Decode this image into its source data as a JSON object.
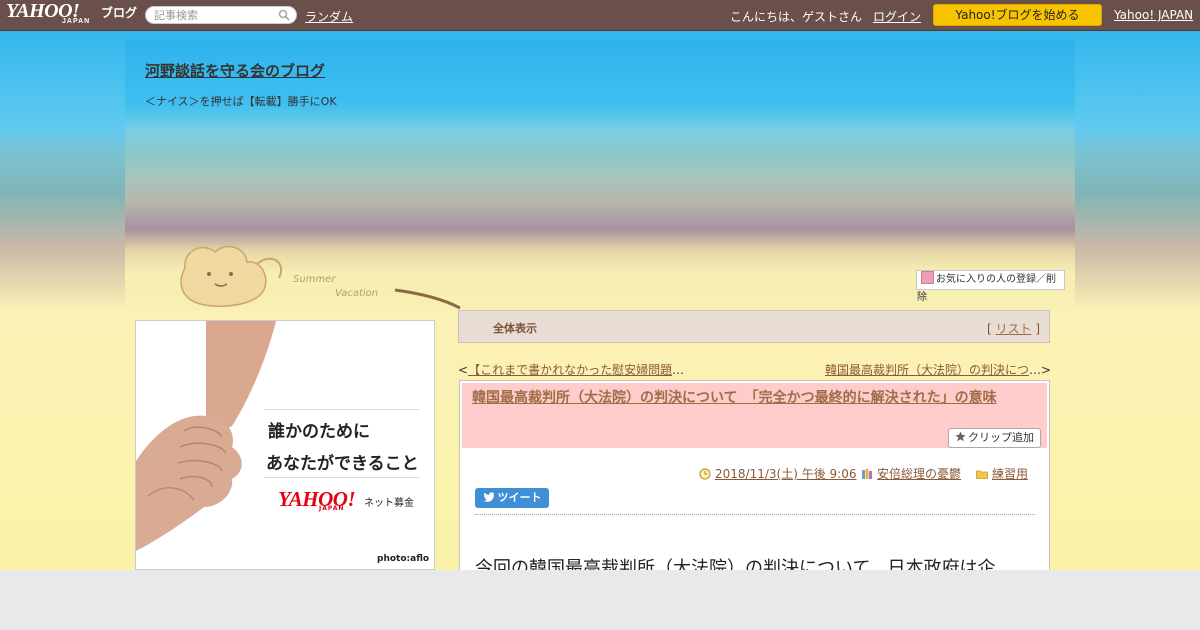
{
  "topbar": {
    "logo_text": "YAHOO!",
    "logo_sub": "JAPAN",
    "logo_suffix": "ブログ",
    "search_placeholder": "記事検索",
    "random_link": "ランダム",
    "greeting": "こんにちは、ゲストさん",
    "login_link": "ログイン",
    "start_button": "Yahoo!ブログを始める",
    "yahoo_japan_link": "Yahoo! JAPAN"
  },
  "blog": {
    "title": "河野談話を守る会のブログ",
    "description": "＜ナイス＞を押せば【転載】勝手にOK",
    "favorite_button": "お気に入りの人の登録／削除"
  },
  "ad": {
    "line1": "誰かのために",
    "line2": "あなたができること",
    "brand": "YAHOO!",
    "brand_sub": "JAPAN",
    "service": "ネット募金",
    "credit": "photo:aflo"
  },
  "view_bar": {
    "label": "全体表示",
    "list_open": "[",
    "list_link": "リスト",
    "list_close": "]"
  },
  "nav": {
    "prev_arrow": "<",
    "prev_title": "【これまで書かれなかった慰安婦問題",
    "prev_ellipsis": "…",
    "next_title": "韓国最高裁判所（大法院）の判決につ",
    "next_ellipsis": "…",
    "next_arrow": ">"
  },
  "article": {
    "title": "韓国最高裁判所（大法院）の判決について　「完全かつ最終的に解決された」の意味",
    "clip_button": "クリップ追加",
    "date": "2018/11/3(土) 午後 9:06",
    "category": "安倍総理の憂鬱",
    "folder": "練習用",
    "tweet_button": "ツイート",
    "body_first_line": "今回の韓国最高裁判所（大法院）の判決について、日本政府は企"
  },
  "colors": {
    "topbar_bg": "#6b4f4a",
    "start_button_bg": "#f8c400",
    "title_band_bg": "#fecccb",
    "link_brown": "#a16c47",
    "tweet_blue": "#3f8fd6"
  }
}
